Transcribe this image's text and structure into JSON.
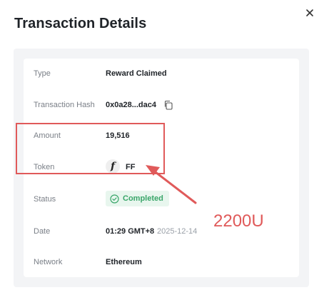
{
  "modal": {
    "title": "Transaction Details",
    "close_icon": "close-icon"
  },
  "rows": {
    "type": {
      "label": "Type",
      "value": "Reward Claimed"
    },
    "hash": {
      "label": "Transaction Hash",
      "value": "0x0a28...dac4",
      "icon": "copy-icon"
    },
    "amount": {
      "label": "Amount",
      "value": "19,516"
    },
    "token": {
      "label": "Token",
      "value": "FF",
      "logo_text": "f",
      "icon": "token-logo"
    },
    "status": {
      "label": "Status",
      "value": "Completed",
      "icon": "check-circle-icon",
      "color": "#3aa66a"
    },
    "date": {
      "label": "Date",
      "time": "01:29 GMT+8",
      "day": "2025-12-14"
    },
    "network": {
      "label": "Network",
      "value": "Ethereum"
    }
  },
  "annotation": {
    "text": "2200U",
    "color": "#e05a5a"
  }
}
